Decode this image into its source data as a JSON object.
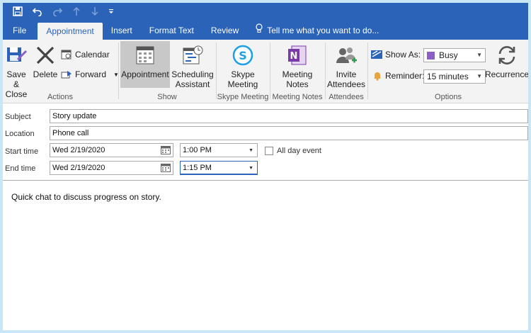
{
  "quick_access": {
    "save_icon": "save-icon",
    "undo_icon": "undo-icon",
    "redo_icon": "redo-icon",
    "up_icon": "arrow-up-icon",
    "down_icon": "arrow-down-icon",
    "customize_icon": "customize-icon"
  },
  "tabs": [
    {
      "label": "File"
    },
    {
      "label": "Appointment"
    },
    {
      "label": "Insert"
    },
    {
      "label": "Format Text"
    },
    {
      "label": "Review"
    },
    {
      "label": "Tell me what you want to do..."
    }
  ],
  "ribbon": {
    "actions": {
      "save_close_1": "Save &",
      "save_close_2": "Close",
      "delete": "Delete",
      "calendar": "Calendar",
      "forward": "Forward",
      "group": "Actions"
    },
    "show": {
      "appointment": "Appointment",
      "scheduling_1": "Scheduling",
      "scheduling_2": "Assistant",
      "group": "Show"
    },
    "skype": {
      "label_1": "Skype",
      "label_2": "Meeting",
      "group": "Skype Meeting"
    },
    "notes": {
      "label_1": "Meeting",
      "label_2": "Notes",
      "group": "Meeting Notes"
    },
    "attendees": {
      "label_1": "Invite",
      "label_2": "Attendees",
      "group": "Attendees"
    },
    "options": {
      "show_as_label": "Show As:",
      "show_as_value": "Busy",
      "busy_color": "#8b5fc6",
      "reminder_label": "Reminder:",
      "reminder_value": "15 minutes",
      "recurrence": "Recurrence",
      "group": "Options"
    }
  },
  "form": {
    "subject_label": "Subject",
    "subject_value": "Story update",
    "location_label": "Location",
    "location_value": "Phone call",
    "start_label": "Start time",
    "start_date": "Wed 2/19/2020",
    "start_time": "1:00 PM",
    "all_day_label": "All day event",
    "end_label": "End time",
    "end_date": "Wed 2/19/2020",
    "end_time": "1:15 PM"
  },
  "body": {
    "text": "Quick chat to discuss progress on story."
  },
  "colors": {
    "accent": "#2b63b8",
    "ribbon_bg": "#f3f3f3"
  }
}
